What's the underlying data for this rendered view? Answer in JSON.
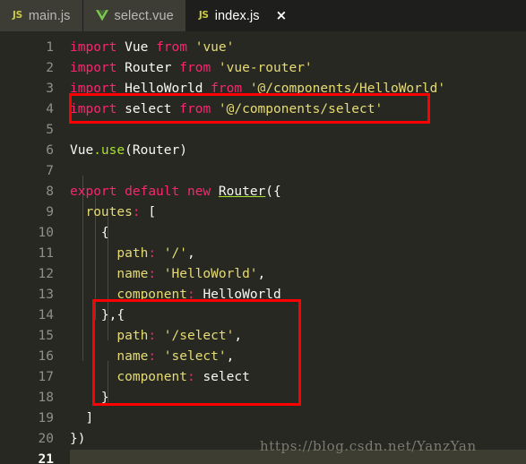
{
  "window": {
    "app": "code-editor",
    "theme_colors": {
      "editor_background": "#272822",
      "tabbar_background": "#1e1f1c",
      "inactive_tab_background": "#3d3d35",
      "line_number": "#8f908a",
      "current_line_highlight": "#3e3d32",
      "annotation_red": "#ff0000",
      "keyword_pink": "#f92672",
      "string_yellow": "#e6db74",
      "function_green": "#a6e22e",
      "text_white": "#f8f8f2"
    }
  },
  "tabbar": {
    "tabs": [
      {
        "label": "main.js",
        "icon": "js-file-icon",
        "active": false,
        "closable": false
      },
      {
        "label": "select.vue",
        "icon": "vue-file-icon",
        "active": false,
        "closable": false
      },
      {
        "label": "index.js",
        "icon": "js-file-icon",
        "active": true,
        "closable": true
      }
    ],
    "close_label": "×"
  },
  "editor": {
    "current_line": 21,
    "line_numbers": [
      "1",
      "2",
      "3",
      "4",
      "5",
      "6",
      "7",
      "8",
      "9",
      "10",
      "11",
      "12",
      "13",
      "14",
      "15",
      "16",
      "17",
      "18",
      "19",
      "20",
      "21"
    ],
    "lines": [
      {
        "n": "1",
        "text": "import Vue from 'vue'"
      },
      {
        "n": "2",
        "text": "import Router from 'vue-router'"
      },
      {
        "n": "3",
        "text": "import HelloWorld from '@/components/HelloWorld'"
      },
      {
        "n": "4",
        "text": "import select from '@/components/select'"
      },
      {
        "n": "5",
        "text": ""
      },
      {
        "n": "6",
        "text": "Vue.use(Router)"
      },
      {
        "n": "7",
        "text": ""
      },
      {
        "n": "8",
        "text": "export default new Router({"
      },
      {
        "n": "9",
        "text": "  routes: ["
      },
      {
        "n": "10",
        "text": "    {"
      },
      {
        "n": "11",
        "text": "      path: '/',"
      },
      {
        "n": "12",
        "text": "      name: 'HelloWorld',"
      },
      {
        "n": "13",
        "text": "      component: HelloWorld"
      },
      {
        "n": "14",
        "text": "    },{"
      },
      {
        "n": "15",
        "text": "      path: '/select',"
      },
      {
        "n": "16",
        "text": "      name: 'select',"
      },
      {
        "n": "17",
        "text": "      component: select"
      },
      {
        "n": "18",
        "text": "    }"
      },
      {
        "n": "19",
        "text": "  ]"
      },
      {
        "n": "20",
        "text": "})"
      },
      {
        "n": "21",
        "text": ""
      }
    ]
  },
  "annotations": [
    {
      "name": "import-select-highlight",
      "target_line": "4",
      "color": "#ff0000"
    },
    {
      "name": "select-route-highlight",
      "target_line": "14-18",
      "color": "#ff0000"
    }
  ],
  "watermark": {
    "text": "https://blog.csdn.net/YanzYan"
  }
}
